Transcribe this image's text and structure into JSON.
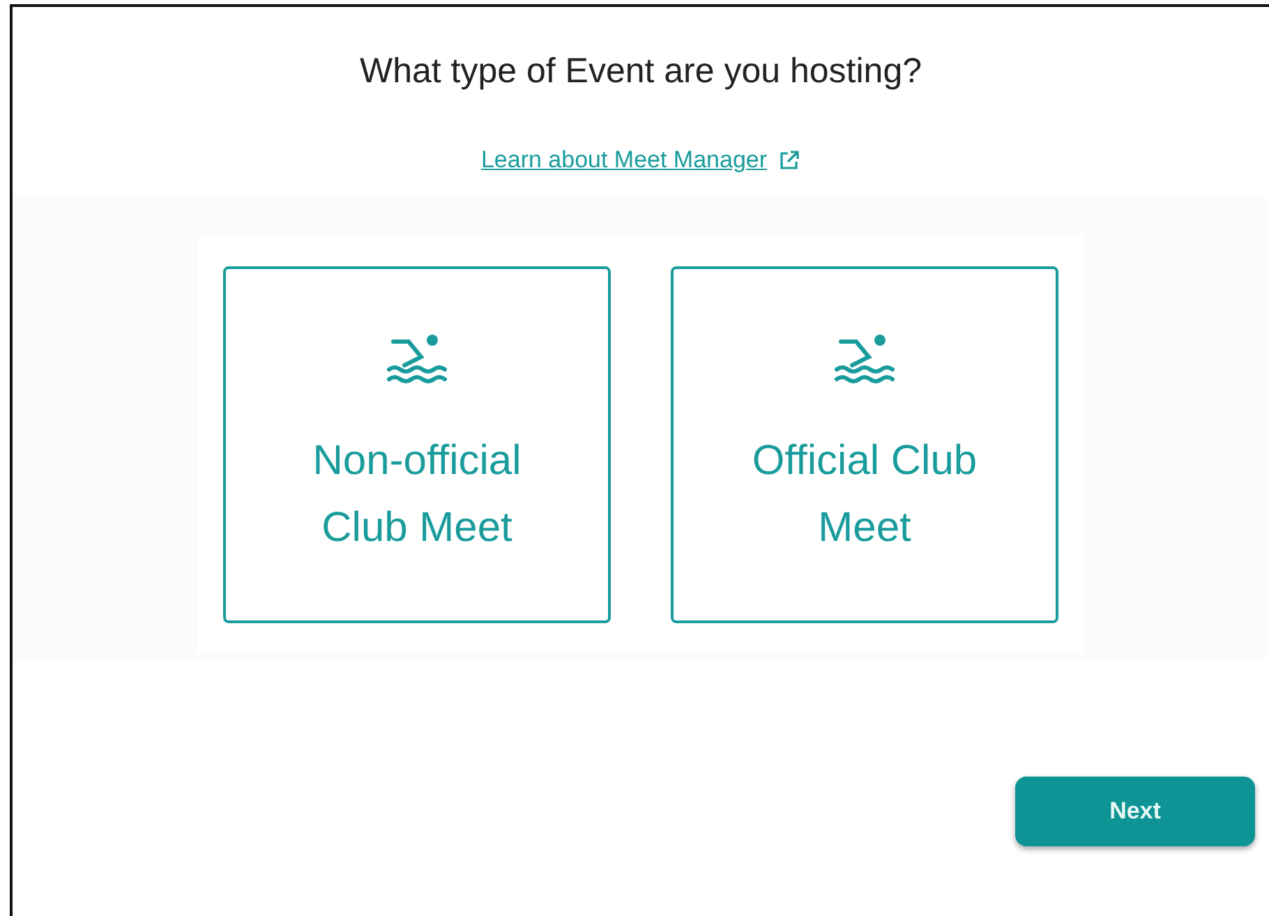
{
  "title": "What type of Event are you hosting?",
  "link": {
    "label": "Learn about Meet Manager"
  },
  "options": [
    {
      "label": "Non-official Club Meet",
      "selected": false
    },
    {
      "label": "Official Club Meet",
      "selected": false
    }
  ],
  "next_button": "Next"
}
